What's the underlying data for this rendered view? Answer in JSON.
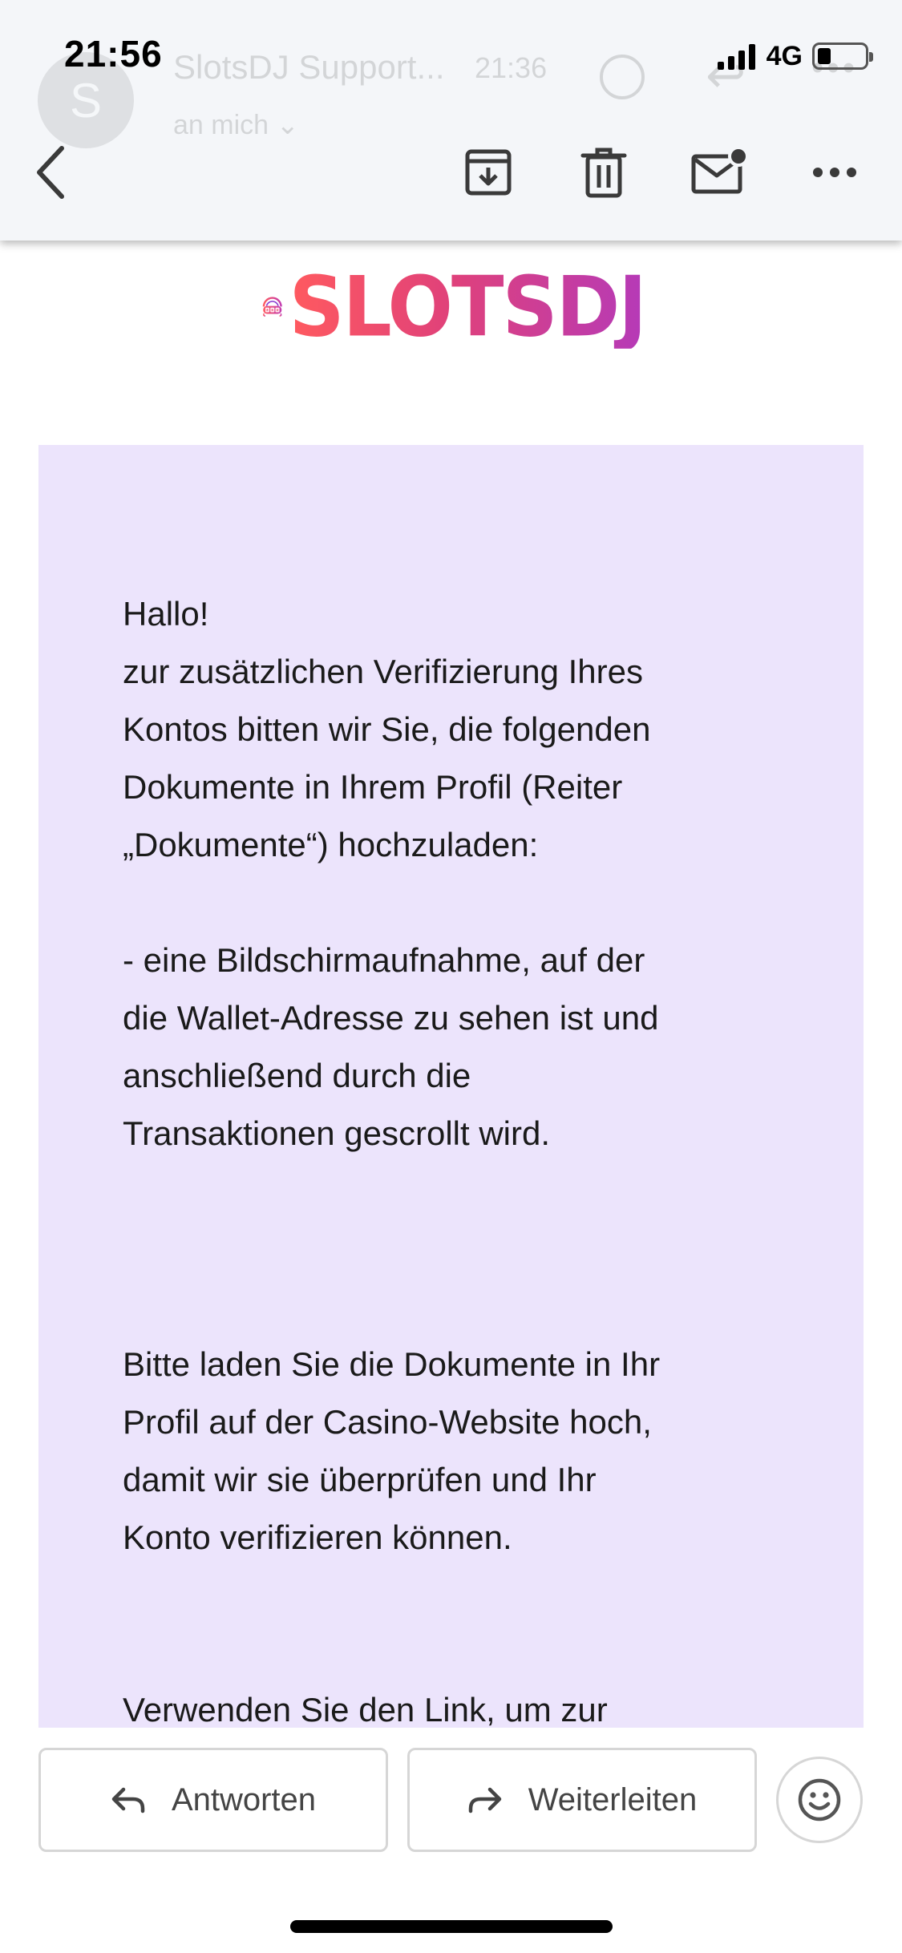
{
  "status_bar": {
    "time": "21:56",
    "network": "4G",
    "battery_level": 0.28
  },
  "sender": {
    "avatar_letter": "S",
    "name": "SlotsDJ Support...",
    "time": "21:36",
    "recipient": "an mich ⌄"
  },
  "toolbar": {
    "back_icon": "chevron-left-icon",
    "archive_icon": "archive-icon",
    "delete_icon": "trash-icon",
    "mark_unread_icon": "mail-unread-icon",
    "more_icon": "more-icon"
  },
  "email": {
    "logo_text": "SLOTSDJ",
    "paragraphs": [
      "Hallo!",
      "zur zusätzlichen Verifizierung Ihres",
      "Kontos bitten wir Sie, die folgenden",
      "Dokumente in Ihrem Profil (Reiter",
      "„Dokumente“) hochzuladen:",
      "- eine Bildschirmaufnahme, auf der",
      "die Wallet-Adresse zu sehen ist und",
      "anschließend durch die",
      "Transaktionen gescrollt wird.",
      "Bitte laden Sie die Dokumente in Ihr",
      "Profil auf der Casino-Website hoch,",
      "damit wir sie überprüfen und Ihr",
      "Konto verifizieren können.",
      "Verwenden Sie den Link, um zur"
    ]
  },
  "actions": {
    "reply_label": "Antworten",
    "forward_label": "Weiterleiten"
  },
  "colors": {
    "card_background": "#ece4fc",
    "logo_gradient_start": "#ff5a5f",
    "logo_gradient_end": "#b53ab8"
  }
}
